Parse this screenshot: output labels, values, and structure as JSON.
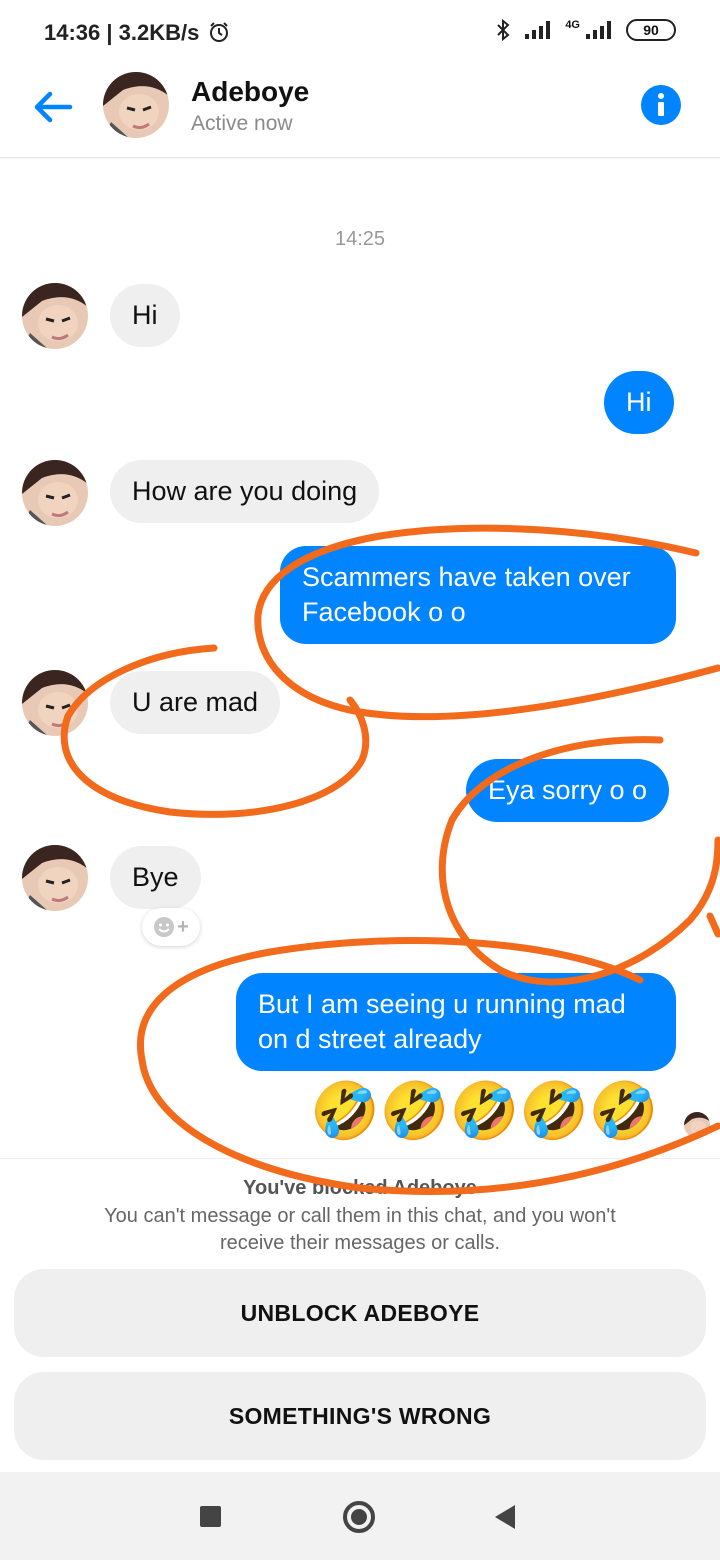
{
  "status_bar": {
    "time": "14:36",
    "speed": "3.2KB/s",
    "network": "4G",
    "battery": "90",
    "icons": [
      "alarm-icon",
      "bluetooth-icon",
      "signal-icon",
      "battery-icon"
    ]
  },
  "header": {
    "contact_name": "Adeboye",
    "status": "Active now",
    "accent_color": "#0084ff",
    "icons": [
      "back-arrow-icon",
      "info-icon"
    ]
  },
  "chat": {
    "timestamp": "14:25",
    "messages": [
      {
        "side": "in",
        "text": "Hi"
      },
      {
        "side": "out",
        "text": "Hi"
      },
      {
        "side": "in",
        "text": "How are you doing"
      },
      {
        "side": "out",
        "lines": [
          "Scammers have taken over",
          "Facebook o o"
        ]
      },
      {
        "side": "in",
        "text": "U are mad"
      },
      {
        "side": "out",
        "text": "Eya sorry o o"
      },
      {
        "side": "in",
        "text": "Bye"
      },
      {
        "side": "out",
        "lines": [
          "But I am seeing u running mad",
          "on d street already"
        ]
      },
      {
        "side": "out",
        "emoji": "🤣🤣🤣🤣🤣"
      }
    ],
    "reaction_button": "+",
    "annotation_color": "#f26a1b"
  },
  "blocked": {
    "title": "You've blocked Adeboye",
    "description_lines": [
      "You can't message or call them in this chat, and you won't",
      "receive their messages or calls."
    ],
    "unblock_label": "UNBLOCK ADEBOYE",
    "wrong_label": "SOMETHING'S WRONG"
  },
  "nav": {
    "icons": [
      "recents-icon",
      "home-icon",
      "back-icon"
    ]
  }
}
